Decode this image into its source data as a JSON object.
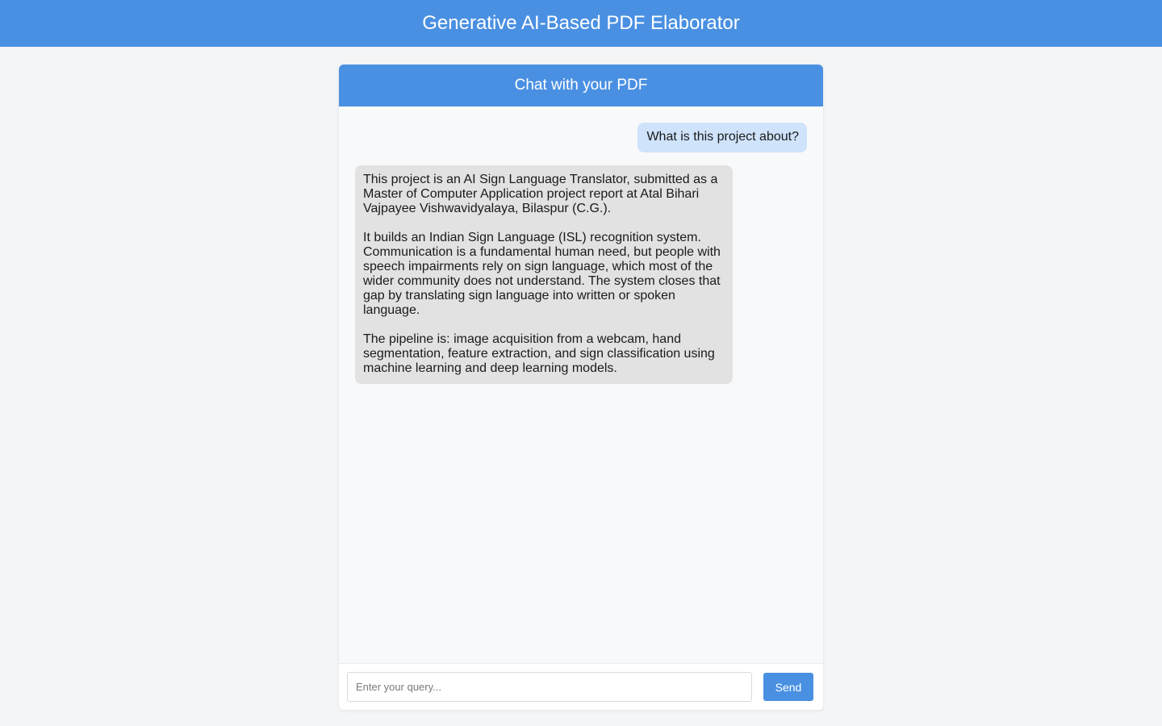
{
  "app": {
    "title": "Generative AI-Based PDF Elaborator"
  },
  "chat": {
    "title": "Chat with your PDF",
    "messages": [
      {
        "role": "user",
        "text": "What is this project about?"
      },
      {
        "role": "assistant",
        "paragraphs": [
          "This project is an AI Sign Language Translator, submitted as a Master of Computer Application project report at Atal Bihari Vajpayee Vishwavidyalaya, Bilaspur (C.G.).",
          "It builds an Indian Sign Language (ISL) recognition system. Communication is a fundamental human need, but people with speech impairments rely on sign language, which most of the wider community does not understand. The system closes that gap by translating sign language into written or spoken language.",
          "The pipeline is: image acquisition from a webcam, hand segmentation, feature extraction, and sign classification using machine learning and deep learning models."
        ]
      }
    ],
    "input": {
      "value": "",
      "placeholder": "Enter your query..."
    },
    "send_label": "Send"
  },
  "colors": {
    "accent": "#4a90e2",
    "user_bubble": "#cfe3fb",
    "assistant_bubble": "#e2e2e2",
    "page_background": "#f4f5f7"
  }
}
